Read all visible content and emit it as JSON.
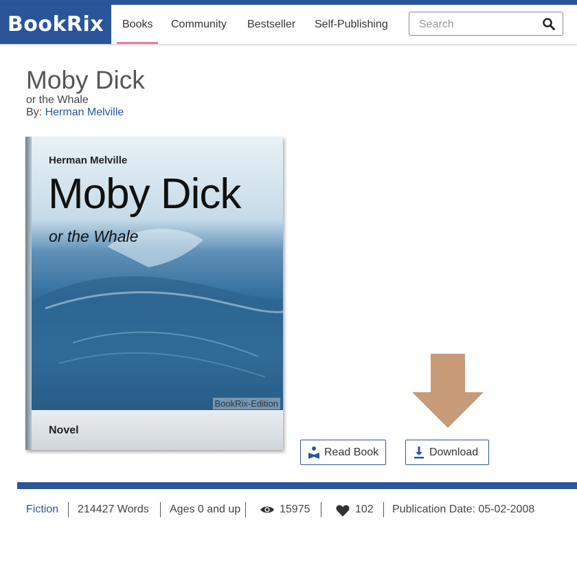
{
  "brand": {
    "logo": "BookRix",
    "accent": "#2a5599",
    "tab_indicator": "#d6879b"
  },
  "nav": {
    "items": [
      "Books",
      "Community",
      "Bestseller",
      "Self-Publishing"
    ],
    "active": "Books"
  },
  "search": {
    "placeholder": "Search",
    "icon": "search-icon"
  },
  "book": {
    "title": "Moby Dick",
    "subtitle": "or the Whale",
    "by_label": "By:",
    "author": "Herman Melville",
    "cover": {
      "author": "Herman Melville",
      "title": "Moby Dick",
      "subtitle": "or the Whale",
      "edition": "BookRix-Edition",
      "genre": "Novel"
    }
  },
  "annotation": {
    "arrow_color": "#c79b78",
    "icon": "down-arrow-icon"
  },
  "actions": {
    "read_label": "Read Book",
    "download_label": "Download"
  },
  "meta": {
    "genre": "Fiction",
    "words": "214427 Words",
    "age": "Ages 0 and up",
    "views": "15975",
    "likes": "102",
    "publication": "Publication Date: 05-02-2008"
  }
}
